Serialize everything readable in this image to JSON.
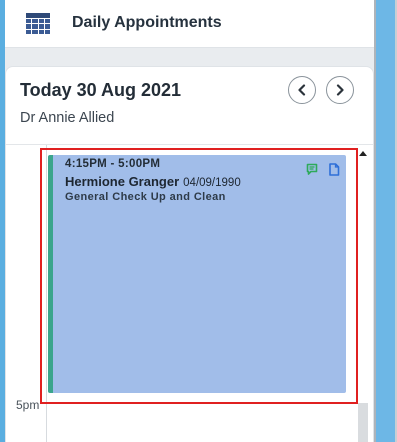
{
  "header": {
    "title": "Daily Appointments",
    "icon": "calendar-grid-icon"
  },
  "schedule": {
    "date_title": "Today 30 Aug 2021",
    "practitioner": "Dr Annie Allied",
    "prev_icon": "chevron-left-icon",
    "next_icon": "chevron-right-icon",
    "time_labels": [
      "5pm"
    ]
  },
  "appointment": {
    "time_range": "4:15PM - 5:00PM",
    "patient_name": "Hermione Granger",
    "dob": "04/09/1990",
    "appointment_type": "General Check Up and Clean",
    "icons": [
      "message-icon",
      "document-icon"
    ]
  },
  "colors": {
    "appointment_fill": "#a1bde9",
    "appointment_accent": "#3aa58c",
    "highlight": "#e02020",
    "chat_icon": "#2eaa5b",
    "doc_icon": "#2e6fd8",
    "header_icon": "#3b5b94"
  }
}
